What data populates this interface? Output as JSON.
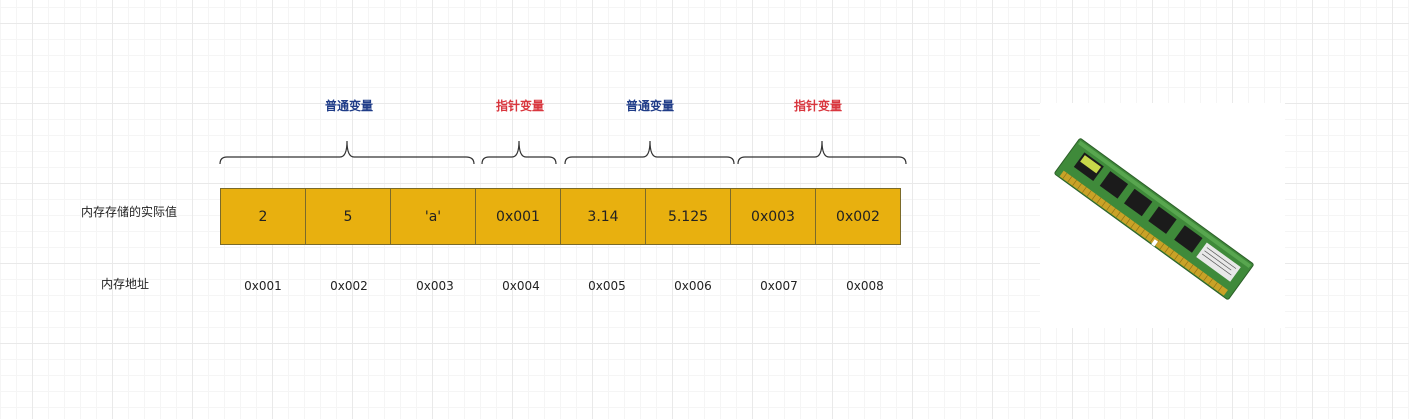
{
  "groups": [
    {
      "label": "普通变量",
      "kind": "normal"
    },
    {
      "label": "指针变量",
      "kind": "pointer"
    },
    {
      "label": "普通变量",
      "kind": "normal"
    },
    {
      "label": "指针变量",
      "kind": "pointer"
    }
  ],
  "row_labels": {
    "values": "内存存储的实际值",
    "addresses": "内存地址"
  },
  "cells": [
    "2",
    "5",
    "'a'",
    "0x001",
    "3.14",
    "5.125",
    "0x003",
    "0x002"
  ],
  "addresses": [
    "0x001",
    "0x002",
    "0x003",
    "0x004",
    "0x005",
    "0x006",
    "0x007",
    "0x008"
  ],
  "colors": {
    "cell_fill": "#e8b00f",
    "normal_label": "#1f3c88",
    "pointer_label": "#d9363e"
  },
  "image": {
    "icon": "ram-module-icon"
  }
}
